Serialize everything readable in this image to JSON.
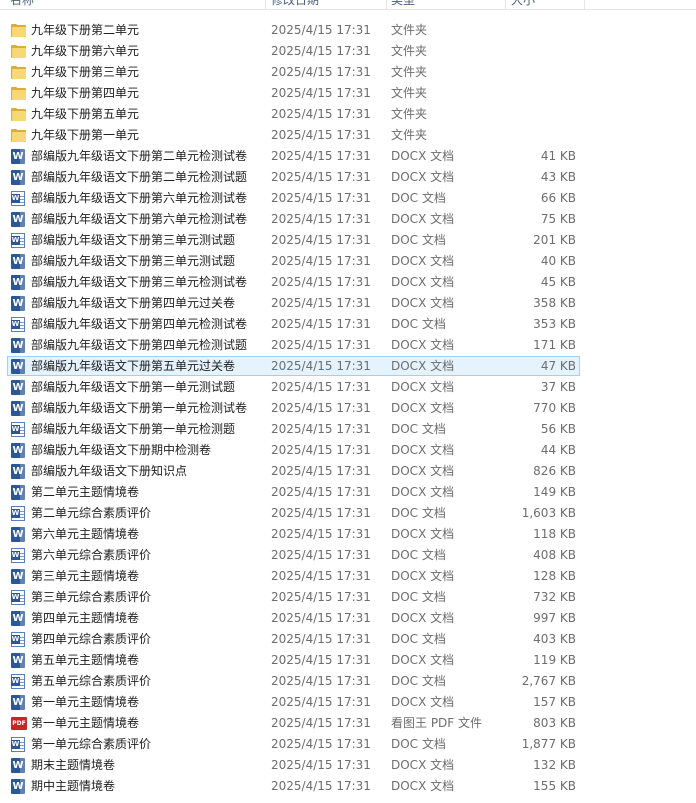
{
  "columns": {
    "name": "名称",
    "date": "修改日期",
    "type": "类型",
    "size": "大小"
  },
  "colors": {
    "folder": "#f8d775",
    "docx": "#2b5797",
    "pdf": "#c52626",
    "selection": "#e5f3ff",
    "selection_border": "#99d1ff"
  },
  "files": [
    {
      "icon": "folder-icon",
      "name": "九年级下册第二单元",
      "date": "2025/4/15 17:31",
      "type": "文件夹",
      "size": ""
    },
    {
      "icon": "folder-icon",
      "name": "九年级下册第六单元",
      "date": "2025/4/15 17:31",
      "type": "文件夹",
      "size": ""
    },
    {
      "icon": "folder-icon",
      "name": "九年级下册第三单元",
      "date": "2025/4/15 17:31",
      "type": "文件夹",
      "size": ""
    },
    {
      "icon": "folder-icon",
      "name": "九年级下册第四单元",
      "date": "2025/4/15 17:31",
      "type": "文件夹",
      "size": ""
    },
    {
      "icon": "folder-icon",
      "name": "九年级下册第五单元",
      "date": "2025/4/15 17:31",
      "type": "文件夹",
      "size": ""
    },
    {
      "icon": "folder-icon",
      "name": "九年级下册第一单元",
      "date": "2025/4/15 17:31",
      "type": "文件夹",
      "size": ""
    },
    {
      "icon": "docx-icon",
      "name": "部编版九年级语文下册第二单元检测试卷",
      "date": "2025/4/15 17:31",
      "type": "DOCX 文档",
      "size": "41 KB"
    },
    {
      "icon": "docx-icon",
      "name": "部编版九年级语文下册第二单元检测试题",
      "date": "2025/4/15 17:31",
      "type": "DOCX 文档",
      "size": "43 KB"
    },
    {
      "icon": "doc-icon",
      "name": "部编版九年级语文下册第六单元检测试卷",
      "date": "2025/4/15 17:31",
      "type": "DOC 文档",
      "size": "66 KB"
    },
    {
      "icon": "docx-icon",
      "name": "部编版九年级语文下册第六单元检测试卷",
      "date": "2025/4/15 17:31",
      "type": "DOCX 文档",
      "size": "75 KB"
    },
    {
      "icon": "doc-icon",
      "name": "部编版九年级语文下册第三单元测试题",
      "date": "2025/4/15 17:31",
      "type": "DOC 文档",
      "size": "201 KB"
    },
    {
      "icon": "docx-icon",
      "name": "部编版九年级语文下册第三单元测试题",
      "date": "2025/4/15 17:31",
      "type": "DOCX 文档",
      "size": "40 KB"
    },
    {
      "icon": "docx-icon",
      "name": "部编版九年级语文下册第三单元检测试卷",
      "date": "2025/4/15 17:31",
      "type": "DOCX 文档",
      "size": "45 KB"
    },
    {
      "icon": "docx-icon",
      "name": "部编版九年级语文下册第四单元过关卷",
      "date": "2025/4/15 17:31",
      "type": "DOCX 文档",
      "size": "358 KB"
    },
    {
      "icon": "doc-icon",
      "name": "部编版九年级语文下册第四单元检测试卷",
      "date": "2025/4/15 17:31",
      "type": "DOC 文档",
      "size": "353 KB"
    },
    {
      "icon": "docx-icon",
      "name": "部编版九年级语文下册第四单元检测试题",
      "date": "2025/4/15 17:31",
      "type": "DOCX 文档",
      "size": "171 KB"
    },
    {
      "icon": "docx-icon",
      "name": "部编版九年级语文下册第五单元过关卷",
      "date": "2025/4/15 17:31",
      "type": "DOCX 文档",
      "size": "47 KB",
      "selected": true
    },
    {
      "icon": "docx-icon",
      "name": "部编版九年级语文下册第一单元测试题",
      "date": "2025/4/15 17:31",
      "type": "DOCX 文档",
      "size": "37 KB"
    },
    {
      "icon": "docx-icon",
      "name": "部编版九年级语文下册第一单元检测试卷",
      "date": "2025/4/15 17:31",
      "type": "DOCX 文档",
      "size": "770 KB"
    },
    {
      "icon": "doc-icon",
      "name": "部编版九年级语文下册第一单元检测题",
      "date": "2025/4/15 17:31",
      "type": "DOC 文档",
      "size": "56 KB"
    },
    {
      "icon": "docx-icon",
      "name": "部编版九年级语文下册期中检测卷",
      "date": "2025/4/15 17:31",
      "type": "DOCX 文档",
      "size": "44 KB"
    },
    {
      "icon": "docx-icon",
      "name": "部编版九年级语文下册知识点",
      "date": "2025/4/15 17:31",
      "type": "DOCX 文档",
      "size": "826 KB"
    },
    {
      "icon": "docx-icon",
      "name": "第二单元主题情境卷",
      "date": "2025/4/15 17:31",
      "type": "DOCX 文档",
      "size": "149 KB"
    },
    {
      "icon": "doc-icon",
      "name": "第二单元综合素质评价",
      "date": "2025/4/15 17:31",
      "type": "DOC 文档",
      "size": "1,603 KB"
    },
    {
      "icon": "docx-icon",
      "name": "第六单元主题情境卷",
      "date": "2025/4/15 17:31",
      "type": "DOCX 文档",
      "size": "118 KB"
    },
    {
      "icon": "doc-icon",
      "name": "第六单元综合素质评价",
      "date": "2025/4/15 17:31",
      "type": "DOC 文档",
      "size": "408 KB"
    },
    {
      "icon": "docx-icon",
      "name": "第三单元主题情境卷",
      "date": "2025/4/15 17:31",
      "type": "DOCX 文档",
      "size": "128 KB"
    },
    {
      "icon": "doc-icon",
      "name": "第三单元综合素质评价",
      "date": "2025/4/15 17:31",
      "type": "DOC 文档",
      "size": "732 KB"
    },
    {
      "icon": "docx-icon",
      "name": "第四单元主题情境卷",
      "date": "2025/4/15 17:31",
      "type": "DOCX 文档",
      "size": "997 KB"
    },
    {
      "icon": "doc-icon",
      "name": "第四单元综合素质评价",
      "date": "2025/4/15 17:31",
      "type": "DOC 文档",
      "size": "403 KB"
    },
    {
      "icon": "docx-icon",
      "name": "第五单元主题情境卷",
      "date": "2025/4/15 17:31",
      "type": "DOCX 文档",
      "size": "119 KB"
    },
    {
      "icon": "doc-icon",
      "name": "第五单元综合素质评价",
      "date": "2025/4/15 17:31",
      "type": "DOC 文档",
      "size": "2,767 KB"
    },
    {
      "icon": "docx-icon",
      "name": "第一单元主题情境卷",
      "date": "2025/4/15 17:31",
      "type": "DOCX 文档",
      "size": "157 KB"
    },
    {
      "icon": "pdf-icon",
      "name": "第一单元主题情境卷",
      "date": "2025/4/15 17:31",
      "type": "看图王 PDF 文件",
      "size": "803 KB"
    },
    {
      "icon": "doc-icon",
      "name": "第一单元综合素质评价",
      "date": "2025/4/15 17:31",
      "type": "DOC 文档",
      "size": "1,877 KB"
    },
    {
      "icon": "docx-icon",
      "name": "期末主题情境卷",
      "date": "2025/4/15 17:31",
      "type": "DOCX 文档",
      "size": "132 KB"
    },
    {
      "icon": "docx-icon",
      "name": "期中主题情境卷",
      "date": "2025/4/15 17:31",
      "type": "DOCX 文档",
      "size": "155 KB"
    }
  ]
}
